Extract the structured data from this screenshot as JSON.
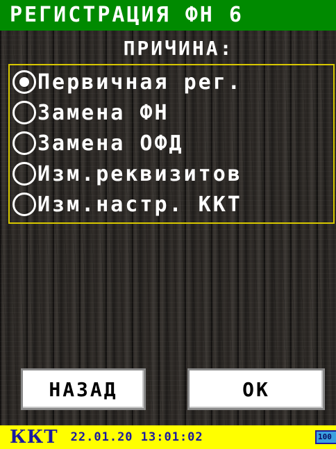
{
  "header": {
    "title": "РЕГИСТРАЦИЯ ФН 6",
    "title_bg_color": "#008a00"
  },
  "reason": {
    "heading": "ПРИЧИНА:",
    "options": [
      {
        "label": "Первичная рег.",
        "selected": true
      },
      {
        "label": "Замена ФН",
        "selected": false
      },
      {
        "label": "Замена ОФД",
        "selected": false
      },
      {
        "label": "Изм.реквизитов",
        "selected": false
      },
      {
        "label": "Изм.настр. ККТ",
        "selected": false
      }
    ],
    "frame_color": "#d8c800"
  },
  "buttons": {
    "back_label": "НАЗАД",
    "ok_label": "OK"
  },
  "status": {
    "device": "ККТ",
    "datetime": "22.01.20 13:01:02",
    "battery": "100",
    "bar_color": "#ffff00",
    "text_color": "#1a1aa0"
  }
}
